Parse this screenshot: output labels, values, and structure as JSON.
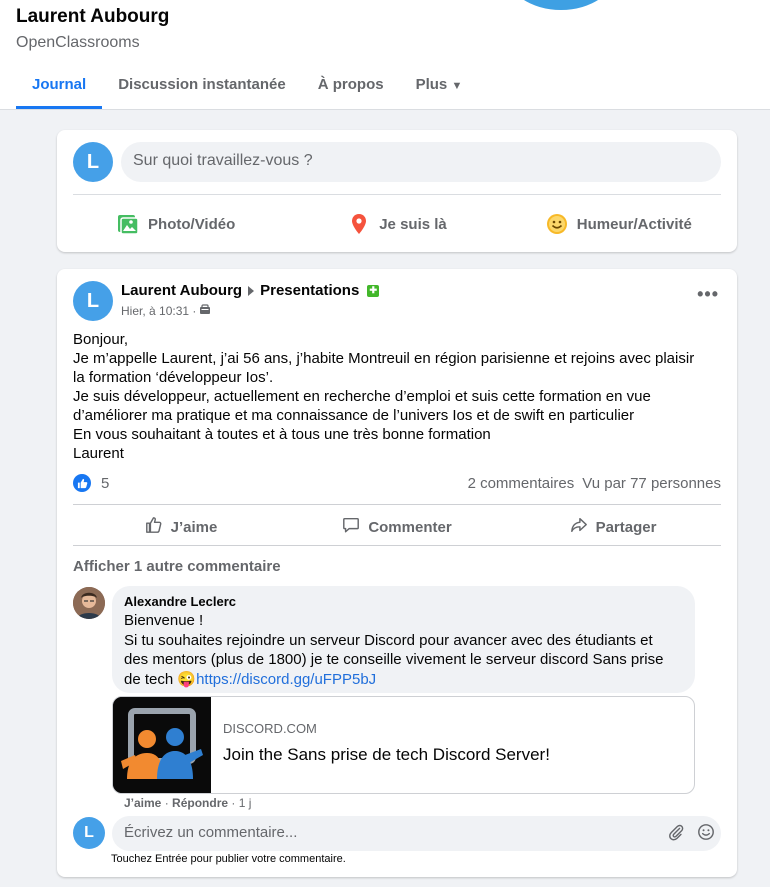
{
  "profile": {
    "name": "Laurent Aubourg",
    "subtitle": "OpenClassrooms"
  },
  "tabs": [
    {
      "label": "Journal",
      "active": true
    },
    {
      "label": "Discussion instantanée"
    },
    {
      "label": "À propos"
    },
    {
      "label": "Plus"
    }
  ],
  "composer": {
    "avatar_initial": "L",
    "placeholder": "Sur quoi travaillez-vous ?",
    "actions": [
      {
        "label": "Photo/Vidéo",
        "icon": "photo-icon"
      },
      {
        "label": "Je suis là",
        "icon": "location-pin-icon"
      },
      {
        "label": "Humeur/Activité",
        "icon": "smiley-icon"
      }
    ]
  },
  "post": {
    "avatar_initial": "L",
    "author": "Laurent Aubourg",
    "group": "Presentations",
    "time": "Hier, à 10:31 ·",
    "text": [
      "Bonjour,",
      "Je m’appelle Laurent, j’ai 56 ans, j’habite Montreuil en région parisienne et rejoins avec plaisir",
      "la formation ‘développeur Ios’.",
      "Je suis développeur, actuellement en recherche d’emploi et suis cette formation en vue",
      "d’améliorer ma pratique et ma connaissance de l’univers Ios et de swift en particulier",
      "En vous souhaitant à toutes et à tous une très bonne formation",
      "Laurent"
    ],
    "likes": "5",
    "comments_count": "2 commentaires",
    "views": "Vu par 77 personnes",
    "actions": {
      "like": "J’aime",
      "comment": "Commenter",
      "share": "Partager"
    },
    "more_comments": "Afficher 1 autre commentaire"
  },
  "comment": {
    "author": "Alexandre Leclerc",
    "lines": [
      "Bienvenue !",
      "Si tu souhaites rejoindre un serveur Discord pour avancer avec des étudiants et",
      "des mentors (plus de 1800) je te conseille vivement le serveur discord Sans prise"
    ],
    "last_line_prefix": "de tech ",
    "emoji": "😜",
    "link": "https://discord.gg/uFPP5bJ",
    "preview_domain": "DISCORD.COM",
    "preview_title": "Join the Sans prise de tech Discord Server!",
    "meta_like": "J’aime",
    "meta_reply": "Répondre",
    "meta_time": "· 1 j"
  },
  "reply": {
    "avatar_initial": "L",
    "placeholder": "Écrivez un commentaire...",
    "hint": "Touchez Entrée pour publier votre commentaire."
  },
  "colors": {
    "accent": "#1877f2",
    "avatar": "#45a0e8",
    "link": "#216fdb",
    "badge": "#42b72a"
  }
}
